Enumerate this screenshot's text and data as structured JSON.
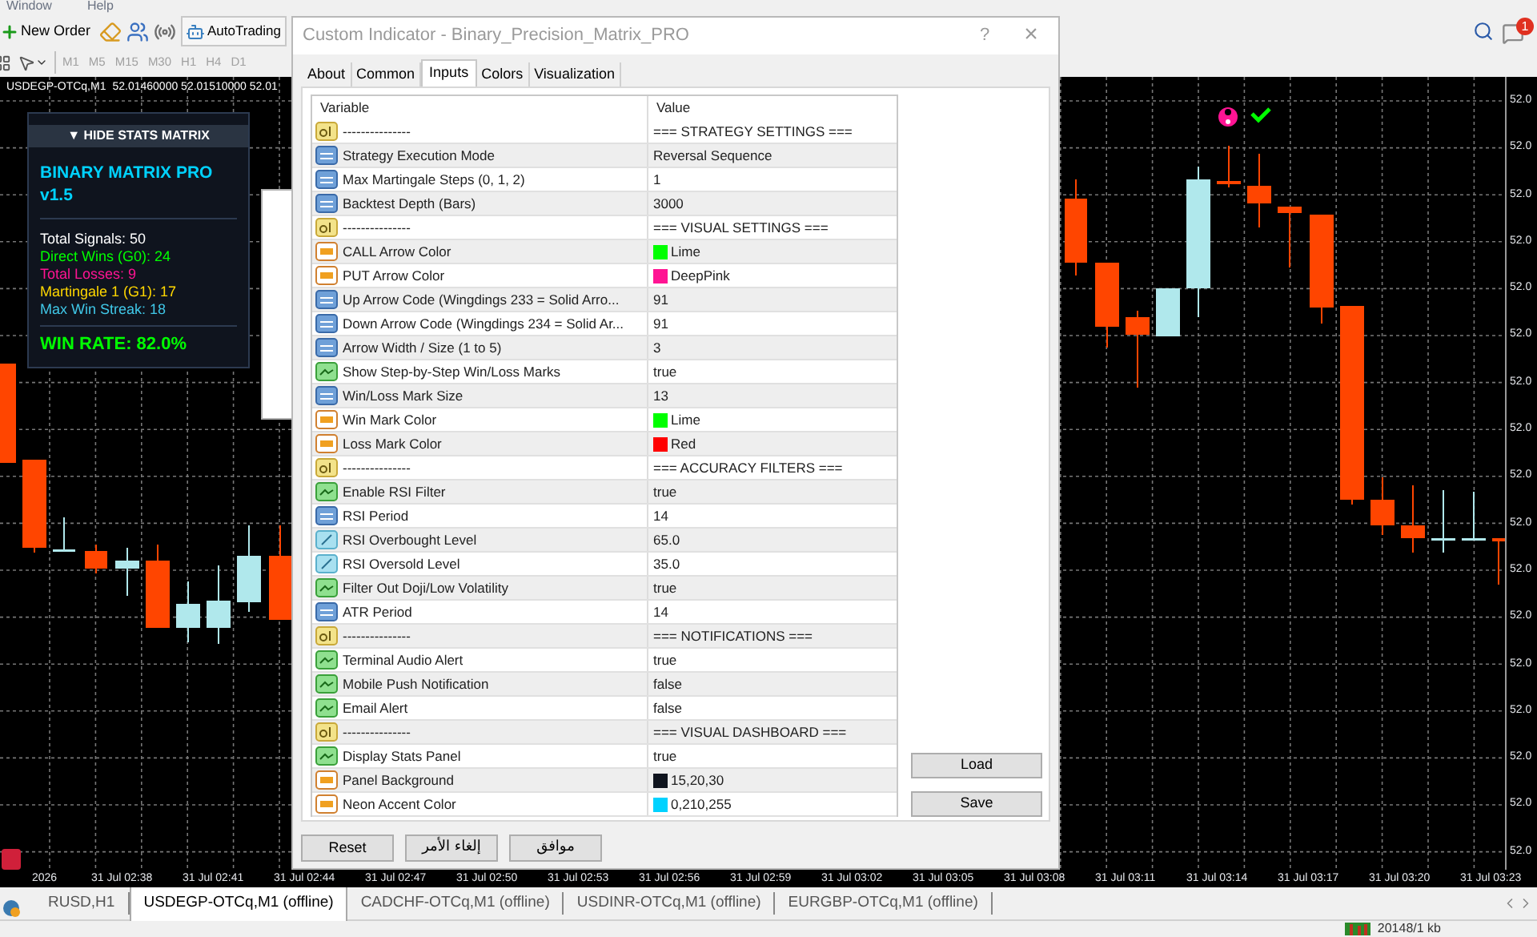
{
  "menu": [
    "Window",
    "Help"
  ],
  "toolbar": {
    "new_order": "New Order",
    "autotrading": "AutoTrading",
    "notification_count": "1"
  },
  "timeframes": [
    "M1",
    "M5",
    "M15",
    "M30",
    "H1",
    "H4",
    "D1"
  ],
  "chart": {
    "symbol": "USDEGP-OTCq,M1",
    "prices": "52.01460000 52.01510000 52.01",
    "price_labels": [
      "52.0",
      "52.0",
      "52.0",
      "52.0",
      "52.0",
      "52.0",
      "52.0",
      "52.0",
      "52.0",
      "52.0",
      "52.0",
      "52.0",
      "52.0",
      "52.0",
      "52.0",
      "52.0",
      "52.0"
    ],
    "time_labels": [
      "2026",
      "31 Jul 02:38",
      "31 Jul 02:41",
      "31 Jul 02:44",
      "31 Jul 02:47",
      "31 Jul 02:50",
      "31 Jul 02:53",
      "31 Jul 02:56",
      "31 Jul 02:59",
      "31 Jul 03:02",
      "31 Jul 03:05",
      "31 Jul 03:08",
      "31 Jul 03:11",
      "31 Jul 03:14",
      "31 Jul 03:17",
      "31 Jul 03:20",
      "31 Jul 03:23"
    ]
  },
  "stats_panel": {
    "toggle": "▼ HIDE STATS MATRIX",
    "title": "BINARY MATRIX PRO v1.5",
    "lines": [
      {
        "text": "Total Signals: 50",
        "color": "#ffffff"
      },
      {
        "text": "Direct Wins (G0): 24",
        "color": "#00ff00"
      },
      {
        "text": "Total Losses: 9",
        "color": "#ff1493"
      },
      {
        "text": "Martingale 1 (G1): 17",
        "color": "#ffd700"
      },
      {
        "text": "Max Win Streak: 18",
        "color": "#40c8e8"
      }
    ],
    "win_rate": "WIN RATE: 82.0%"
  },
  "dialog": {
    "title": "Custom Indicator - Binary_Precision_Matrix_PRO",
    "help": "?",
    "close": "×",
    "tabs": [
      {
        "label": "About",
        "selected": false
      },
      {
        "label": "Common",
        "selected": false
      },
      {
        "label": "Inputs",
        "selected": true
      },
      {
        "label": "Colors",
        "selected": false
      },
      {
        "label": "Visualization",
        "selected": false
      }
    ],
    "columns": [
      "Variable",
      "Value"
    ],
    "rows": [
      {
        "kind": "string",
        "variable": "---------------",
        "value": "=== STRATEGY SETTINGS ==="
      },
      {
        "kind": "int",
        "variable": "Strategy Execution Mode",
        "value": "Reversal Sequence"
      },
      {
        "kind": "int",
        "variable": "Max Martingale Steps (0, 1, 2)",
        "value": "1"
      },
      {
        "kind": "int",
        "variable": "Backtest Depth (Bars)",
        "value": "3000"
      },
      {
        "kind": "string",
        "variable": "---------------",
        "value": "=== VISUAL SETTINGS ==="
      },
      {
        "kind": "color",
        "variable": "CALL Arrow Color",
        "value": "Lime",
        "color": "#00ff00"
      },
      {
        "kind": "color",
        "variable": "PUT Arrow Color",
        "value": "DeepPink",
        "color": "#ff1493"
      },
      {
        "kind": "int",
        "variable": "Up Arrow Code (Wingdings 233 = Solid Arro...",
        "value": "91"
      },
      {
        "kind": "int",
        "variable": "Down Arrow Code (Wingdings 234 = Solid Ar...",
        "value": "91"
      },
      {
        "kind": "int",
        "variable": "Arrow Width / Size (1 to 5)",
        "value": "3"
      },
      {
        "kind": "bool",
        "variable": "Show Step-by-Step Win/Loss Marks",
        "value": "true"
      },
      {
        "kind": "int",
        "variable": "Win/Loss Mark Size",
        "value": "13"
      },
      {
        "kind": "color",
        "variable": "Win Mark Color",
        "value": "Lime",
        "color": "#00ff00"
      },
      {
        "kind": "color",
        "variable": "Loss Mark Color",
        "value": "Red",
        "color": "#ff0000"
      },
      {
        "kind": "string",
        "variable": "---------------",
        "value": "=== ACCURACY FILTERS ==="
      },
      {
        "kind": "bool",
        "variable": "Enable RSI Filter",
        "value": "true"
      },
      {
        "kind": "int",
        "variable": "RSI Period",
        "value": "14"
      },
      {
        "kind": "double",
        "variable": "RSI Overbought Level",
        "value": "65.0"
      },
      {
        "kind": "double",
        "variable": "RSI Oversold Level",
        "value": "35.0"
      },
      {
        "kind": "bool",
        "variable": "Filter Out Doji/Low Volatility",
        "value": "true"
      },
      {
        "kind": "int",
        "variable": "ATR Period",
        "value": "14"
      },
      {
        "kind": "string",
        "variable": "---------------",
        "value": "=== NOTIFICATIONS ==="
      },
      {
        "kind": "bool",
        "variable": "Terminal Audio Alert",
        "value": "true"
      },
      {
        "kind": "bool",
        "variable": "Mobile Push Notification",
        "value": "false"
      },
      {
        "kind": "bool",
        "variable": "Email Alert",
        "value": "false"
      },
      {
        "kind": "string",
        "variable": "---------------",
        "value": "=== VISUAL DASHBOARD ==="
      },
      {
        "kind": "bool",
        "variable": "Display Stats Panel",
        "value": "true"
      },
      {
        "kind": "color",
        "variable": "Panel Background",
        "value": "15,20,30",
        "color": "#0f141e"
      },
      {
        "kind": "color",
        "variable": "Neon Accent Color",
        "value": "0,210,255",
        "color": "#00d2ff"
      }
    ],
    "side_buttons": [
      "Load",
      "Save"
    ],
    "reset_button": "Reset",
    "cancel_button": "إلغاء الأمر",
    "ok_button": "موافق"
  },
  "chart_tabs": [
    {
      "label": "RUSD,H1",
      "selected": false
    },
    {
      "label": "USDEGP-OTCq,M1 (offline)",
      "selected": true
    },
    {
      "label": "CADCHF-OTCq,M1 (offline)",
      "selected": false
    },
    {
      "label": "USDINR-OTCq,M1 (offline)",
      "selected": false
    },
    {
      "label": "EURGBP-OTCq,M1 (offline)",
      "selected": false
    }
  ],
  "status_bar": {
    "traffic": "20148/1 kb"
  }
}
